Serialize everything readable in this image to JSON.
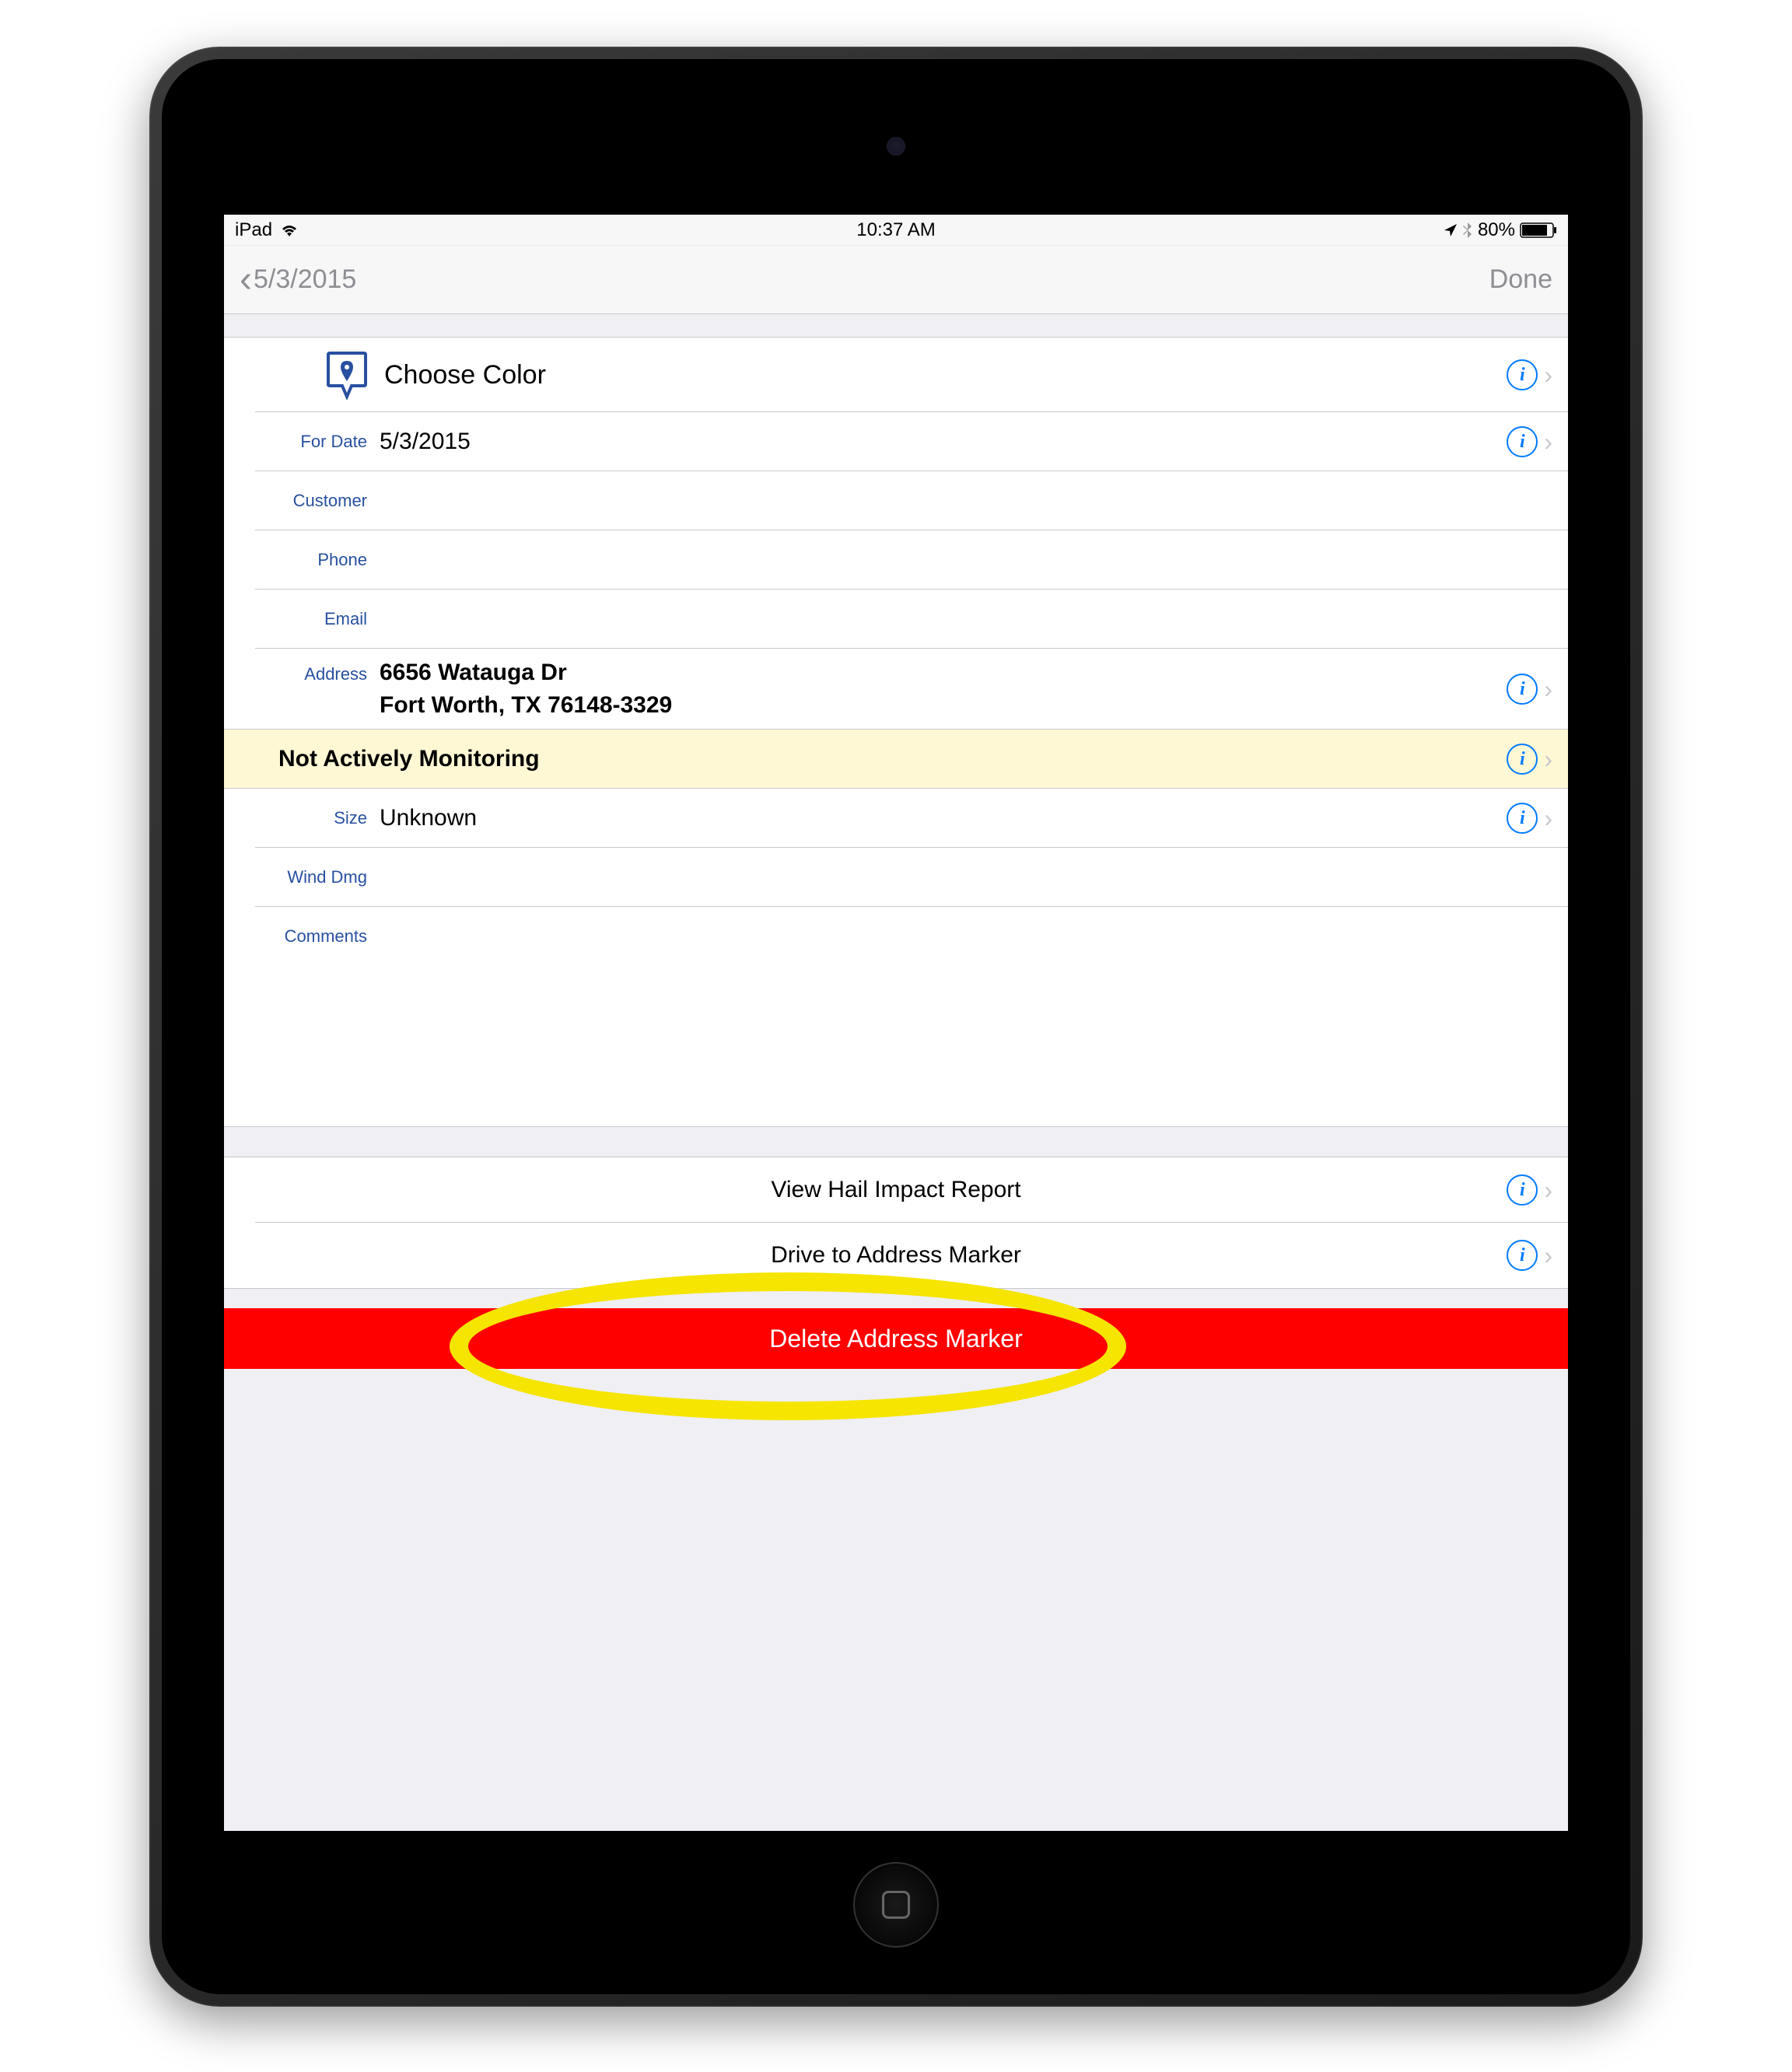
{
  "statusBar": {
    "carrier": "iPad",
    "time": "10:37 AM",
    "batteryPercent": "80%"
  },
  "nav": {
    "backLabel": "5/3/2015",
    "doneLabel": "Done"
  },
  "form": {
    "chooseColor": {
      "label": "Choose Color"
    },
    "forDate": {
      "label": "For Date",
      "value": "5/3/2015"
    },
    "customer": {
      "label": "Customer",
      "value": ""
    },
    "phone": {
      "label": "Phone",
      "value": ""
    },
    "email": {
      "label": "Email",
      "value": ""
    },
    "address": {
      "label": "Address",
      "line1": "6656 Watauga Dr",
      "line2": "Fort Worth, TX 76148-3329"
    },
    "monitoring": {
      "value": "Not Actively Monitoring"
    },
    "size": {
      "label": "Size",
      "value": "Unknown"
    },
    "windDmg": {
      "label": "Wind Dmg",
      "value": ""
    },
    "comments": {
      "label": "Comments",
      "value": ""
    }
  },
  "actions": {
    "viewReport": "View Hail Impact Report",
    "driveTo": "Drive to Address Marker",
    "delete": "Delete Address Marker"
  }
}
